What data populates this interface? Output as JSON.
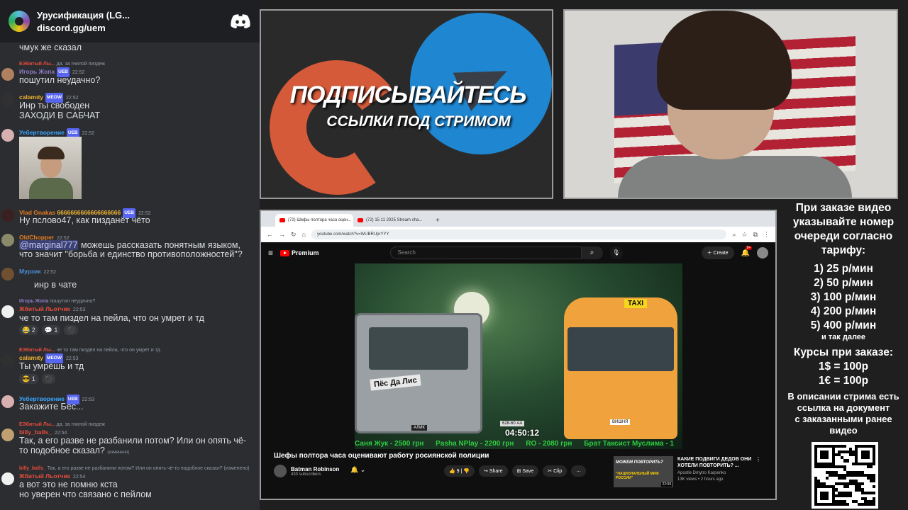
{
  "discord": {
    "server_name": "Урусификация (LG...",
    "invite": "discord.gg/uem",
    "first_line": "чмук же сказал",
    "messages": [
      {
        "reply_name": "ЕЭбитый Лы...",
        "reply_text": "да, за гнилой пиздеж",
        "user": "Игорь Жопа",
        "tag": "UEB",
        "time": "22:52",
        "lines": [
          "пошутил неудачно?"
        ],
        "avatar_color": "#b08060",
        "name_color": "#8e7cc3"
      },
      {
        "user": "calamıty",
        "tag": "MEOW",
        "time": "22:52",
        "lines": [
          "Инр ты свободен",
          "ЗАХОДИ В САБЧАТ"
        ],
        "avatar_color": "#303030",
        "name_color": "#f0b232"
      },
      {
        "user": "Уебертворение",
        "tag": "UEB",
        "time": "22:52",
        "lines": [],
        "avatar_color": "#d8b0b0",
        "name_color": "#3aa6ff"
      },
      {
        "user": "Vlad Gnakas",
        "tag": "UEB",
        "time": "22:52",
        "extra": "6666666666666666666",
        "lines": [
          "Ну пслово47, как пизданёт чёто"
        ],
        "avatar_color": "#3a2020",
        "name_color": "#e67e22"
      },
      {
        "user": "OldChopper",
        "time": "22:52",
        "lines": [
          "@marginal777 можешь рассказать понятным языком,",
          "что значит \"борьба и единство противоположностей\"?"
        ],
        "mention": "@marginal777",
        "avatar_color": "#8a8a6a",
        "name_color": "#e67e22"
      },
      {
        "user": "Мурзик",
        "time": "22:52",
        "lines": [
          "инр в чате"
        ],
        "avatar_color": "#705030",
        "name_color": "#4a90d9"
      },
      {
        "reply_name": "Игорь Жопа",
        "reply_text": "пошутил неудачно?",
        "user": "Жбитый Льотчик",
        "time": "22:53",
        "lines": [
          "че то там пиздел на пейла, что он умрет и тд"
        ],
        "reactions": [
          "😂 2",
          "💬 1",
          "⚫"
        ],
        "avatar_color": "#f0f0f0",
        "name_color": "#e74c3c"
      },
      {
        "reply_name": "ЕЭбитый Лы...",
        "reply_text": "че то там пиздел на пейла, что он умрет и тд",
        "user": "calamıty",
        "tag": "MEOW",
        "time": "22:53",
        "lines": [
          "Ты умрёшь и тд"
        ],
        "reactions": [
          "😎 1",
          "⚫"
        ],
        "avatar_color": "#303030",
        "name_color": "#f0b232"
      },
      {
        "user": "Уебертворение",
        "tag": "UEB",
        "time": "22:53",
        "lines": [
          "Закажите Бес..."
        ],
        "avatar_color": "#d8b0b0",
        "name_color": "#3aa6ff"
      },
      {
        "reply_name": "ЕЭбитый Лы...",
        "reply_text": "да, за гнилой пиздеж",
        "user": "billy_balls_",
        "time": "22:54",
        "lines": [
          "Так, а его разве не разбанили потом? Или он опять чё-",
          "то подобное сказал?"
        ],
        "edited": "(изменено)",
        "avatar_color": "#c0a070",
        "name_color": "#e74c3c"
      },
      {
        "reply_name": "billy_balls_",
        "reply_text": "Так, а его разве не разбанили потом? Или он опять чё-то подобное сказал?",
        "reply_edited": "(изменено)",
        "user": "Жбитый Льотчик",
        "time": "22:54",
        "lines": [
          "а вот это не помню кста",
          "но уверен что связано с пейлом"
        ],
        "avatar_color": "#f0f0f0",
        "name_color": "#e74c3c"
      }
    ]
  },
  "promo": {
    "title": "ПОДПИСЫВАЙТЕСЬ",
    "subtitle": "ССЫЛКИ ПОД СТРИМОМ"
  },
  "browser": {
    "tabs": [
      "(72) Шефы полтора часа оцен...",
      "(72) 15 11 2025 Stream cha..."
    ],
    "new_tab": "+",
    "url": "youtube.com/watch?v=WUBRUprYYY"
  },
  "youtube": {
    "logo": "Premium",
    "search_placeholder": "Search",
    "create_label": "Create",
    "notif_count": "9+",
    "timer": "04:50:12",
    "ticker": [
      "Саня Жук - 2500 грн",
      "Pasha NPlay - 2200 грн",
      "RO - 2080 грн",
      "Брат Таксист Муслима - 1"
    ],
    "truck_label": "Пёс Да Лис",
    "truck_plate": "АЛИК",
    "truck_plate2": "628-60 АА",
    "taxi_sign": "TAXI",
    "bus_plate": "ВИШНЯ",
    "video_title": "Шефы полтора часа оценивают работу росиянской полиции",
    "channel_name": "Batman Robinson",
    "channel_subs": "433 subscribers",
    "likes": "9",
    "share": "Share",
    "save": "Save",
    "clip": "Clip",
    "more": "…",
    "rec": {
      "thumb_text": "МОЖЕМ ПОВТОРИТЬ?",
      "thumb_sub": "\"НАЦИОНАЛЬНЫЙ МИФ РОССИИ\"",
      "duration": "22:09",
      "title": "КАКИЕ ПОДВИГИ ДЕДОВ ОНИ ХОТЕЛИ ПОВТОРИТЬ? ...",
      "author": "Apostle Dmytro Karpenko",
      "meta": "13K views • 2 hours ago"
    }
  },
  "prices": {
    "header": [
      "При заказе видео",
      "указывайте номер",
      "очереди согласно",
      "тарифу:"
    ],
    "tiers": [
      "1) 25 р/мин",
      "2) 50 р/мин",
      "3) 100 р/мин",
      "4) 200 р/мин",
      "5) 400 р/мин"
    ],
    "more": "и так далее",
    "rates_title": "Курсы при заказе:",
    "rates": [
      "1$ = 100р",
      "1€ = 100р"
    ],
    "desc": [
      "В описании стрима есть",
      "ссылка на документ",
      "с заказанными ранее",
      "видео"
    ]
  }
}
